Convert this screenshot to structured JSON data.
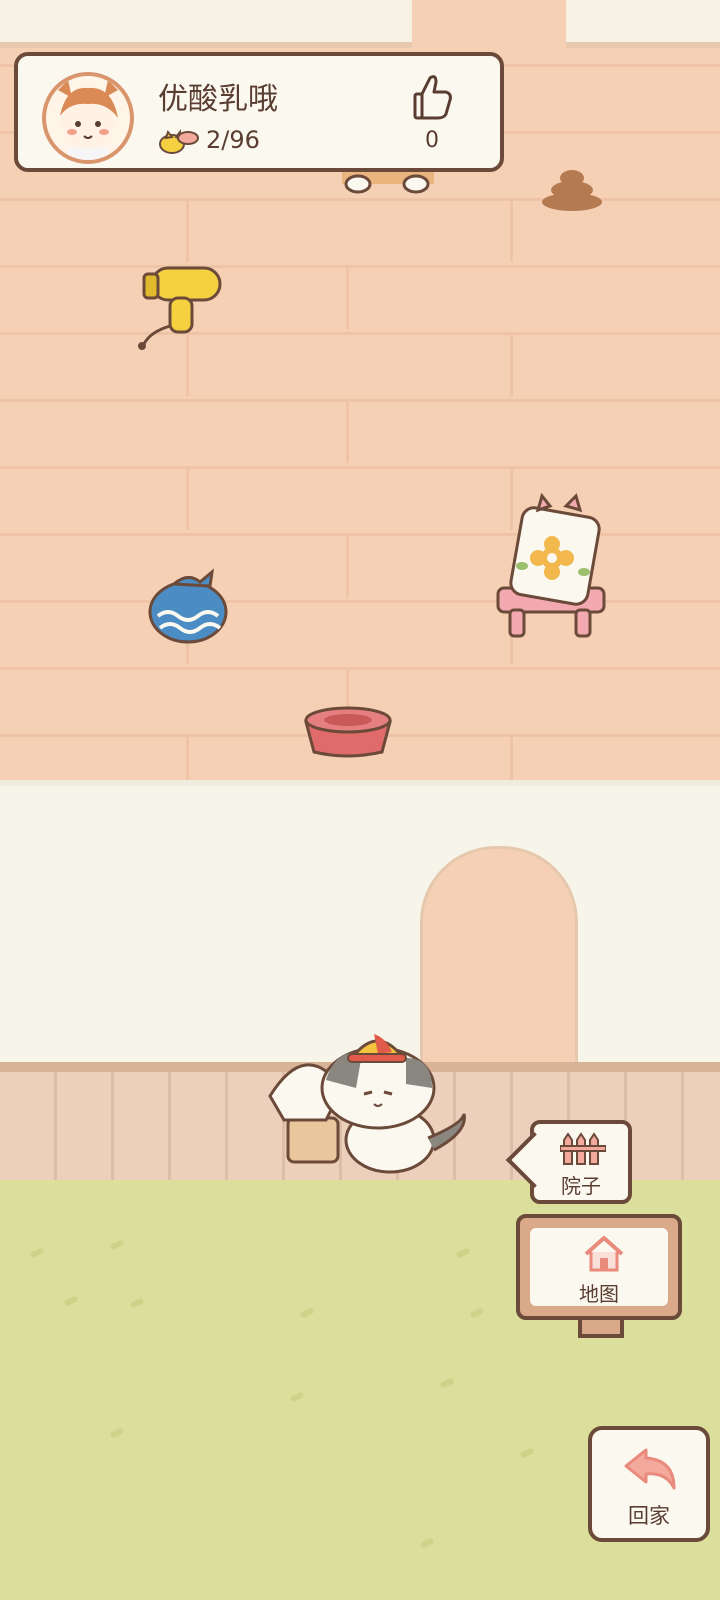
{
  "player": {
    "name": "优酸乳哦",
    "fish_count": "2/96",
    "likes": "0"
  },
  "nav": {
    "yard_label": "院子",
    "map_label": "地图",
    "home_label": "回家"
  },
  "icons": {
    "profile_fish": "fish-coin-icon",
    "likes": "thumbs-up-icon",
    "yard": "fence-icon",
    "map": "house-icon",
    "home": "back-arrow-icon"
  },
  "colors": {
    "accent_pink": "#e98a7c",
    "outline_brown": "#6b4a3a",
    "panel_cream": "#fbf8f0"
  }
}
